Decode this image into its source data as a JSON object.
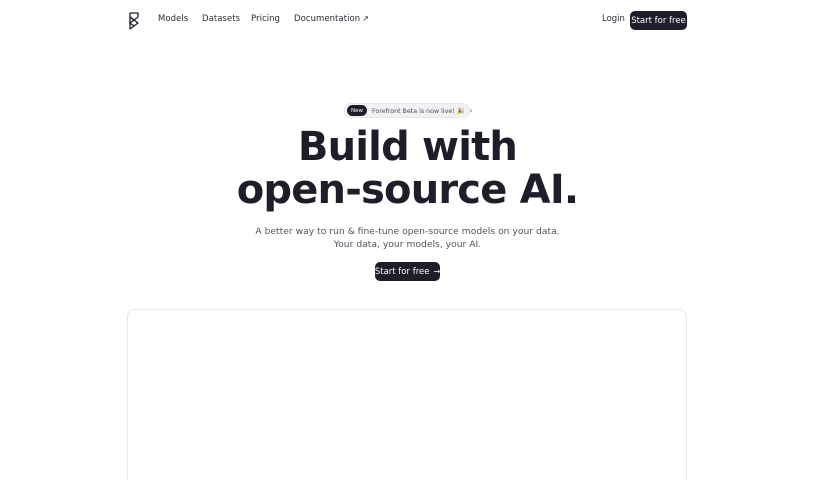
{
  "nav": {
    "logo_icon": "brand-logo-icon",
    "links": [
      {
        "label": "Models"
      },
      {
        "label": "Datasets"
      },
      {
        "label": "Pricing"
      },
      {
        "label": "Documentation",
        "external_icon": "↗"
      }
    ],
    "login_label": "Login",
    "cta_label": "Start for free"
  },
  "announcement": {
    "badge": "New",
    "text": "Forefront Beta is now live! 🎉",
    "chevron": "›"
  },
  "hero": {
    "title_line1": "Build with",
    "title_line2": "open-source AI.",
    "subtitle_line1": "A better way to run & fine-tune open-source models on your data.",
    "subtitle_line2": "Your data, your models, your AI.",
    "cta_label": "Start for free",
    "cta_arrow": "→"
  },
  "colors": {
    "primary_dark": "#1e1e2a",
    "muted_text": "#54545e",
    "pill_bg": "#f2f2f5",
    "card_border": "#e7e7ec"
  }
}
